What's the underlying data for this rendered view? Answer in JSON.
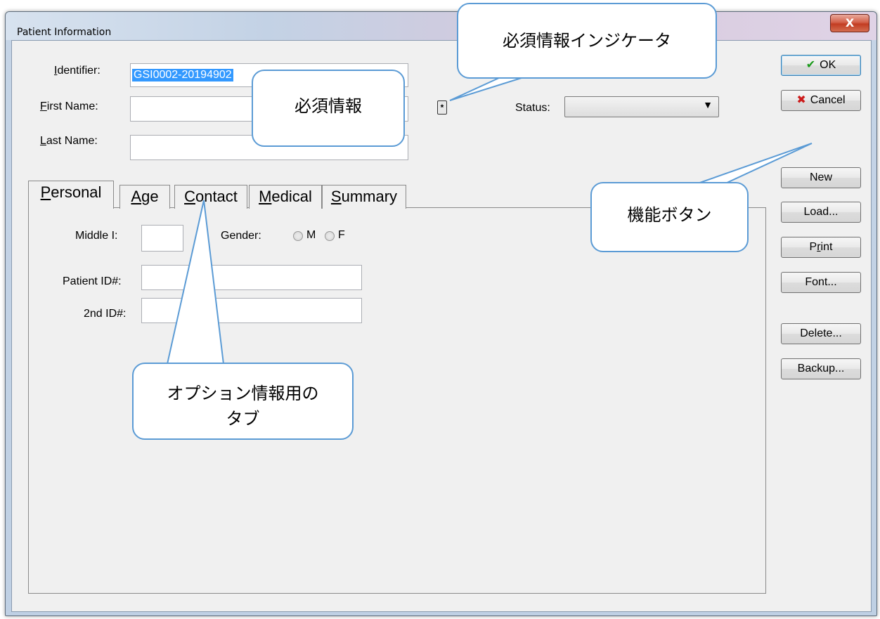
{
  "window": {
    "title": "Patient Information",
    "close_glyph": "X"
  },
  "form": {
    "identifier_label": "Identifier:",
    "identifier_value": "GSI0002-20194902",
    "first_name_label": "First Name:",
    "last_name_label": "Last Name:",
    "status_label": "Status:",
    "status_value": "",
    "required_indicator_glyph": "*"
  },
  "tabs": [
    {
      "label": "Personal",
      "active": true
    },
    {
      "label": "Age",
      "active": false
    },
    {
      "label": "Contact",
      "active": false
    },
    {
      "label": "Medical",
      "active": false
    },
    {
      "label": "Summary",
      "active": false
    }
  ],
  "personal": {
    "middle_label": "Middle I:",
    "gender_label": "Gender:",
    "gender_m": "M",
    "gender_f": "F",
    "patient_id_label": "Patient ID#:",
    "second_id_label": "2nd ID#:"
  },
  "buttons": {
    "ok": "OK",
    "cancel": "Cancel",
    "new": "New",
    "load": "Load...",
    "print": "Print",
    "font": "Font...",
    "delete": "Delete...",
    "backup": "Backup..."
  },
  "callouts": {
    "required_indicator": "必須情報インジケータ",
    "required_info": "必須情報",
    "function_buttons": "機能ボタン",
    "optional_tabs_line1": "オプション情報用の",
    "optional_tabs_line2": "タブ"
  },
  "colors": {
    "callout_border": "#5b9bd5",
    "selection": "#3399ff",
    "ok_check": "#1a9a1a",
    "cancel_x": "#cc1a1a"
  }
}
